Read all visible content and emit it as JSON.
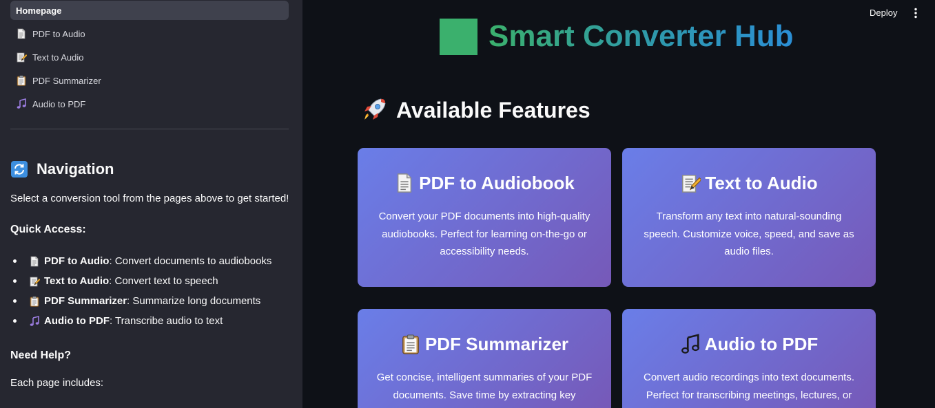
{
  "sidebar": {
    "nav": [
      {
        "label": "Homepage",
        "active": true,
        "icon": ""
      },
      {
        "label": "PDF to Audio",
        "icon": "page-icon"
      },
      {
        "label": "Text to Audio",
        "icon": "memo-icon"
      },
      {
        "label": "PDF Summarizer",
        "icon": "clipboard-icon"
      },
      {
        "label": "Audio to PDF",
        "icon": "music-notes-icon"
      }
    ],
    "navigation_title": "Navigation",
    "navigation_icon": "refresh-arrows-icon",
    "intro": "Select a conversion tool from the pages above to get started!",
    "quick_access_title": "Quick Access:",
    "quick_access": [
      {
        "bold": "PDF to Audio",
        "rest": ": Convert documents to audiobooks",
        "icon": "page-icon"
      },
      {
        "bold": "Text to Audio",
        "rest": ": Convert text to speech",
        "icon": "memo-icon"
      },
      {
        "bold": "PDF Summarizer",
        "rest": ": Summarize long documents",
        "icon": "clipboard-icon"
      },
      {
        "bold": "Audio to PDF",
        "rest": ": Transcribe audio to text",
        "icon": "music-notes-icon"
      }
    ],
    "help_title": "Need Help?",
    "help_text": "Each page includes:"
  },
  "header": {
    "deploy_label": "Deploy",
    "menu_icon": "kebab-menu-icon"
  },
  "main": {
    "title": "Smart Converter Hub",
    "features_title": "Available Features",
    "features_icon": "rocket-icon",
    "cards": [
      {
        "title": "PDF to Audiobook",
        "icon": "page-icon",
        "desc": "Convert your PDF documents into high-quality audiobooks. Perfect for learning on-the-go or accessibility needs."
      },
      {
        "title": "Text to Audio",
        "icon": "memo-icon",
        "desc": "Transform any text into natural-sounding speech. Customize voice, speed, and save as audio files."
      },
      {
        "title": "PDF Summarizer",
        "icon": "clipboard-icon",
        "desc": "Get concise, intelligent summaries of your PDF documents. Save time by extracting key"
      },
      {
        "title": "Audio to PDF",
        "icon": "music-notes-icon",
        "desc": "Convert audio recordings into text documents. Perfect for transcribing meetings, lectures, or"
      }
    ]
  },
  "colors": {
    "sidebar_bg": "#262730",
    "main_bg": "#0e1117",
    "card_gradient_start": "#6a7ee8",
    "card_gradient_end": "#7659b8",
    "title_gradient": [
      "#3bb06d",
      "#2b8fd6"
    ]
  }
}
